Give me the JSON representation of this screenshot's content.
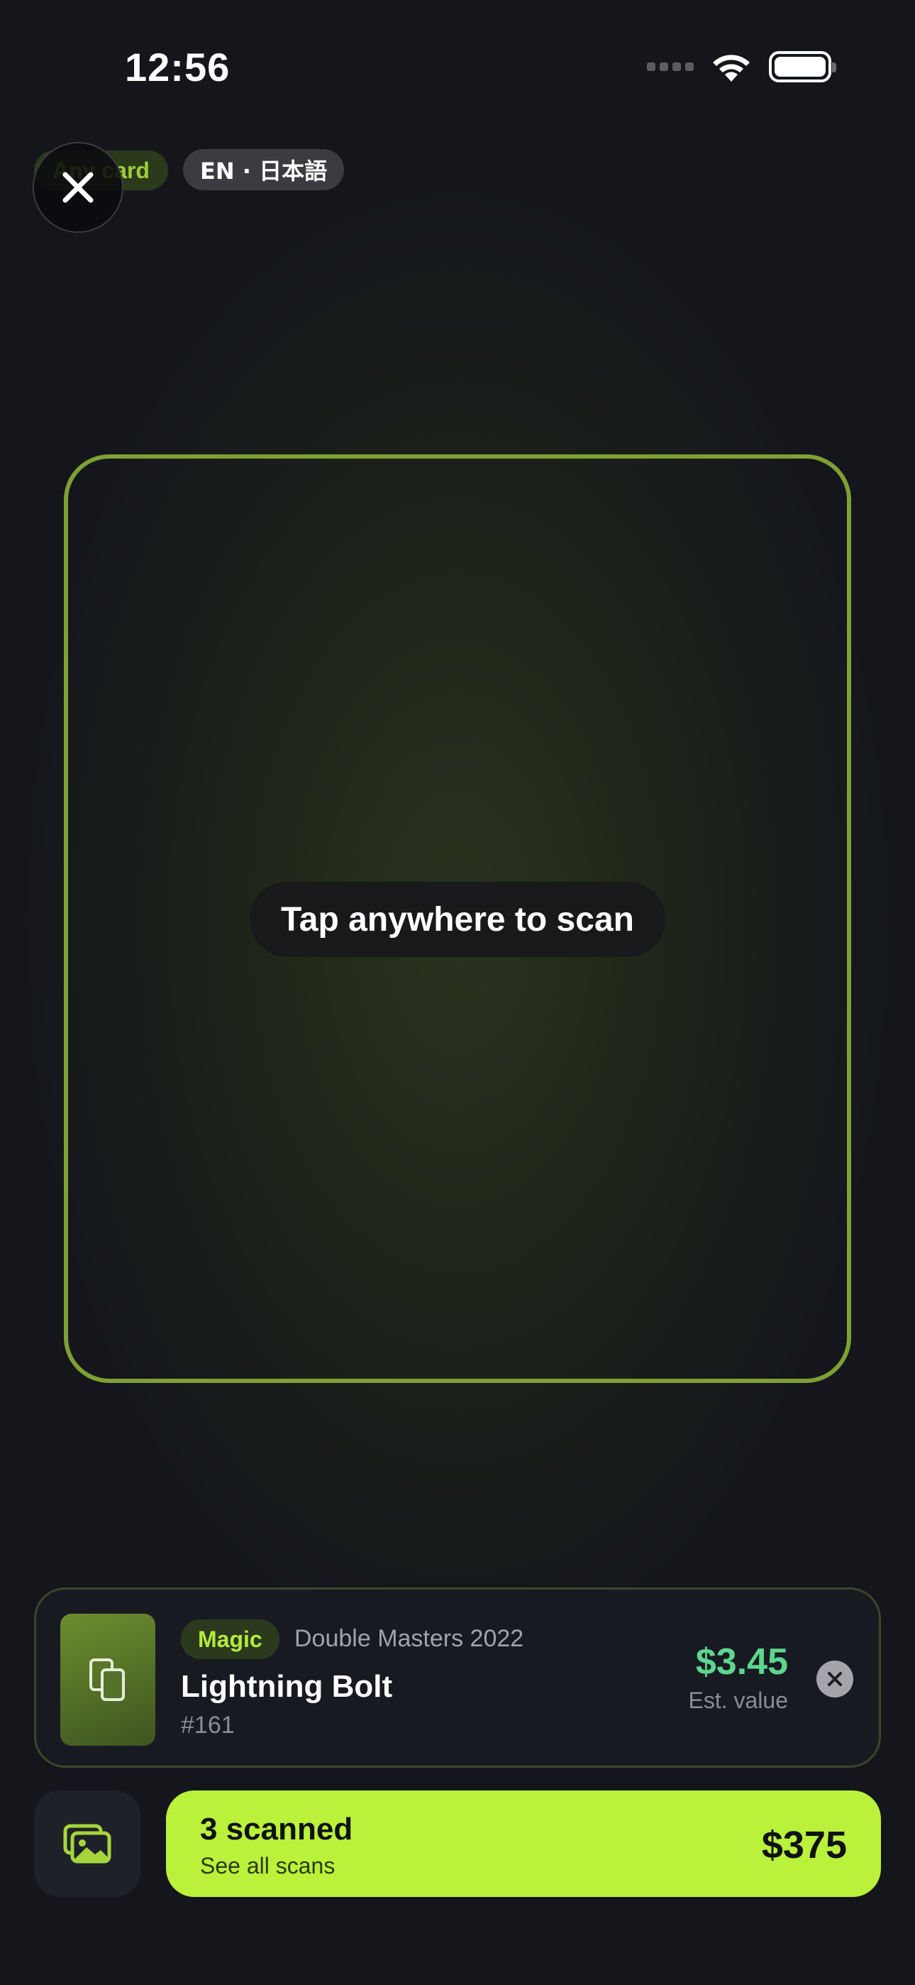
{
  "status_bar": {
    "time": "12:56",
    "icons": [
      "signal-dots-icon",
      "wifi-icon",
      "battery-icon"
    ]
  },
  "top": {
    "mode_chip": "Any card",
    "language_chip": "EN · 日本語",
    "close_icon": "close-icon"
  },
  "scanner": {
    "hint": "Tap anywhere to scan",
    "frame_color": "#7fa033"
  },
  "result": {
    "game": "Magic",
    "set": "Double Masters 2022",
    "name": "Lightning Bolt",
    "number": "#161",
    "price": "$3.45",
    "price_label": "Est. value",
    "thumb_icon": "cards-stack-icon",
    "dismiss_icon": "close-circle-icon"
  },
  "bottom": {
    "gallery_icon": "photo-gallery-icon",
    "scanned_count": "3 scanned",
    "scanned_sub": "See all scans",
    "scanned_total": "$375",
    "accent": "#b9f13b"
  }
}
